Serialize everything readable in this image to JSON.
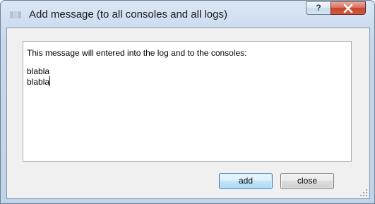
{
  "window": {
    "title": "Add message (to all consoles and all logs)",
    "help_label": "?",
    "close_icon": "close-x-icon"
  },
  "message": {
    "lines": [
      "This message will entered into the log and to the consoles:",
      "",
      "blabla",
      "blabla"
    ]
  },
  "buttons": {
    "add_label": "add",
    "close_label": "close"
  },
  "colors": {
    "titlebar": "#cfdff1",
    "close_button": "#c7442b",
    "default_button_border": "#3c7fb1",
    "client_background": "#f0f0f0"
  }
}
